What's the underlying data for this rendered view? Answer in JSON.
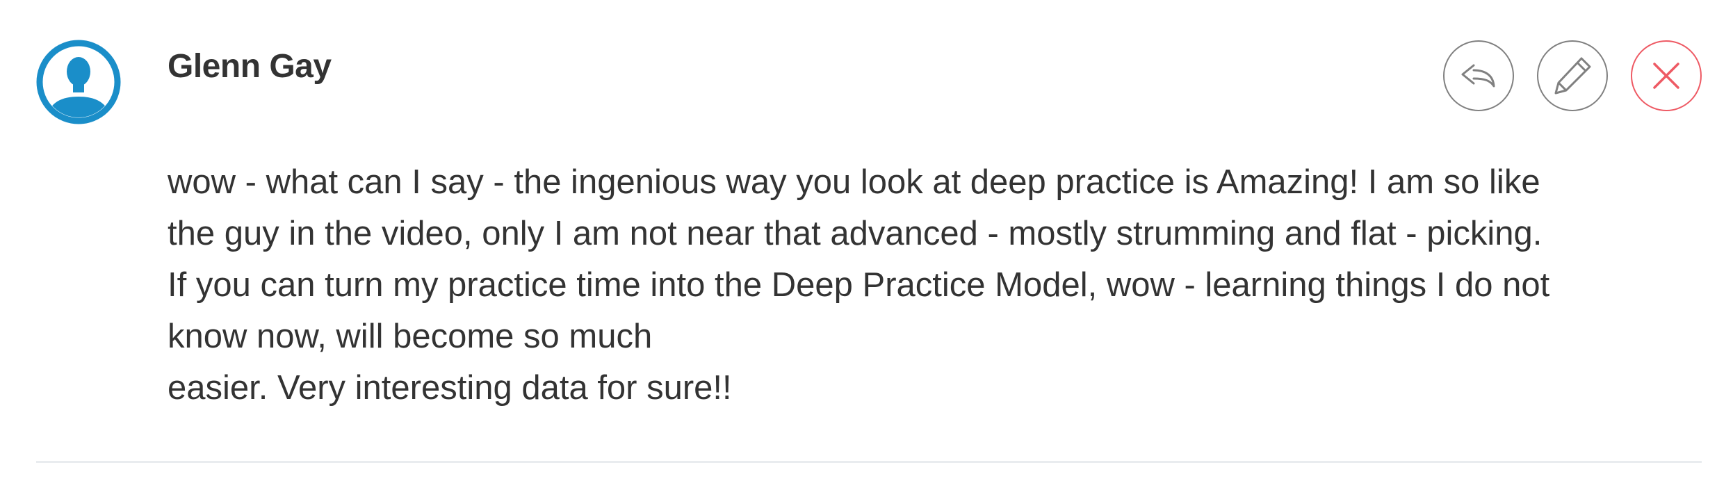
{
  "comment": {
    "author": "Glenn Gay",
    "body_lines": [
      "wow - what can I say - the ingenious way you look at deep practice is Amazing! I am so like",
      "the guy in the video, only I am not near that advanced - mostly strumming and flat - picking.",
      "If you can turn my practice time into the Deep Practice Model, wow - learning things I do not",
      "know now, will become so much",
      "easier. Very interesting data for sure!!"
    ],
    "avatar_icon": "user-silhouette-icon",
    "actions": [
      {
        "name": "reply",
        "icon": "reply-arrow-icon"
      },
      {
        "name": "edit",
        "icon": "pencil-icon"
      },
      {
        "name": "delete",
        "icon": "close-x-icon"
      }
    ]
  },
  "colors": {
    "avatar": "#1a8ec9",
    "text": "#333333",
    "button_border": "#808080",
    "delete": "#ee5a64",
    "divider": "#e9ecef"
  }
}
